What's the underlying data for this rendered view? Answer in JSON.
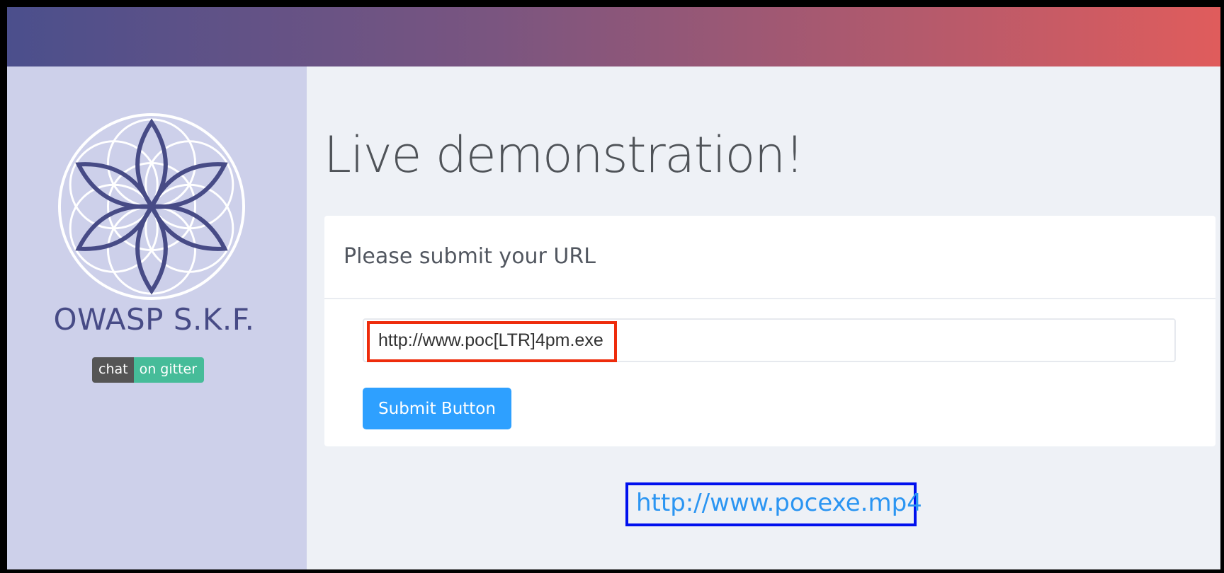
{
  "sidebar": {
    "brand": "OWASP S.K.F.",
    "chat_badge": {
      "left": "chat",
      "right": "on gitter"
    }
  },
  "main": {
    "title": "Live demonstration!",
    "card": {
      "header": "Please submit your URL",
      "url_value": "http://www.poc[LTR]4pm.exe",
      "submit_label": "Submit Button"
    },
    "result_link": "http://www.pocexe.mp4"
  },
  "colors": {
    "accent_blue": "#2ea0ff",
    "highlight_red": "#ee2c0c",
    "highlight_blue": "#0010ee",
    "brand_purple": "#474b86"
  }
}
